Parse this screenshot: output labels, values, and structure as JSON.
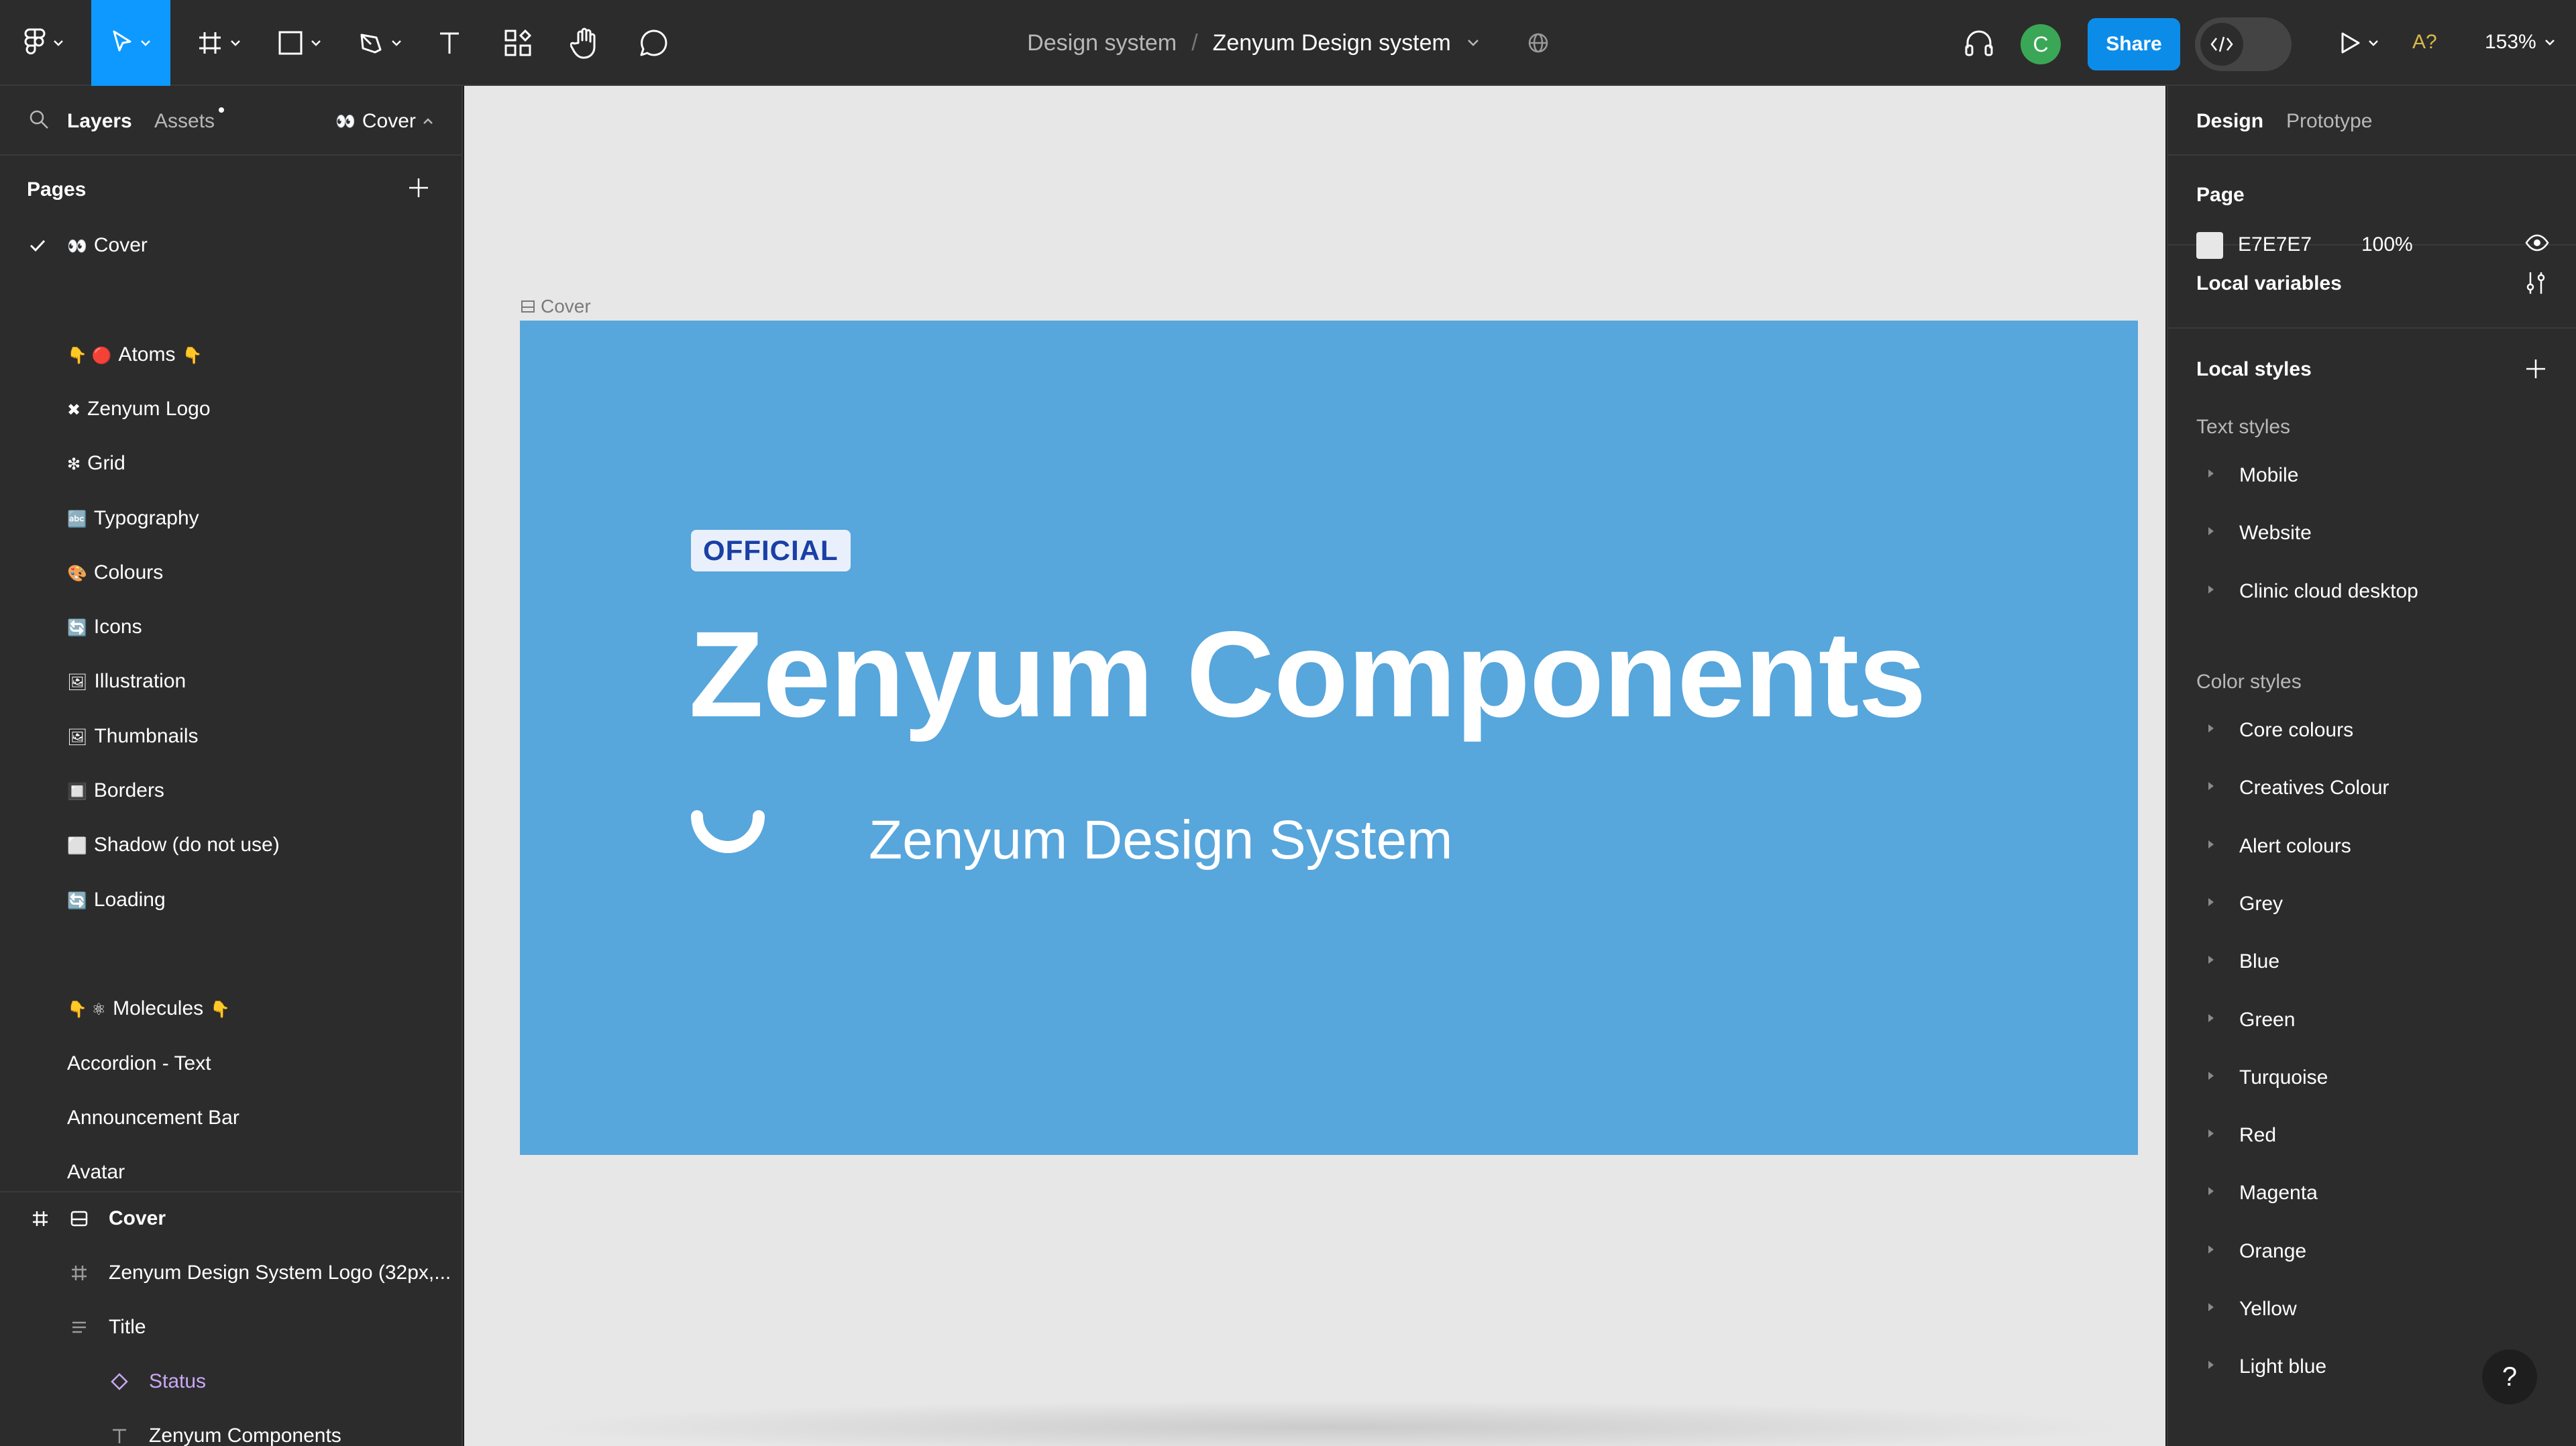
{
  "toolbar": {
    "breadcrumb_project": "Design system",
    "breadcrumb_separator": "/",
    "breadcrumb_file": "Zenyum Design system",
    "avatar_initial": "C",
    "share_label": "Share",
    "a_label": "A?",
    "zoom": "153%",
    "colors": {
      "active": "#0d99ff",
      "share": "#0c8ce9",
      "avatar": "#3aa756"
    }
  },
  "left_panel": {
    "tabs": {
      "layers": "Layers",
      "assets": "Assets"
    },
    "current_page": "Cover",
    "pages_heading": "Pages",
    "pages": [
      {
        "label": "Cover",
        "emoji": "👀",
        "selected": true
      },
      {
        "label": "",
        "emoji": ""
      },
      {
        "label": "Atoms",
        "emoji": "👇 🔴",
        "trail": "👇"
      },
      {
        "label": "Zenyum Logo",
        "emoji": "✖"
      },
      {
        "label": "Grid",
        "emoji": "❇"
      },
      {
        "label": "Typography",
        "emoji": "🔤"
      },
      {
        "label": "Colours",
        "emoji": "🎨"
      },
      {
        "label": "Icons",
        "emoji": "🔄"
      },
      {
        "label": "Illustration",
        "emoji": "🖼"
      },
      {
        "label": "Thumbnails",
        "emoji": "🖼"
      },
      {
        "label": "Borders",
        "emoji": "🔲"
      },
      {
        "label": "Shadow (do not use)",
        "emoji": "⬜"
      },
      {
        "label": "Loading",
        "emoji": "🔄"
      },
      {
        "label": "",
        "emoji": ""
      },
      {
        "label": "Molecules",
        "emoji": "👇 ⚛",
        "trail": "👇"
      },
      {
        "label": "Accordion - Text",
        "emoji": ""
      },
      {
        "label": "Announcement Bar",
        "emoji": ""
      },
      {
        "label": "Avatar",
        "emoji": ""
      }
    ],
    "layers": [
      {
        "name": "Cover",
        "kind": "frame",
        "bold": true
      },
      {
        "name": "Zenyum Design System Logo (32px,...",
        "kind": "frame"
      },
      {
        "name": "Title",
        "kind": "autolayout"
      },
      {
        "name": "Status",
        "kind": "instance",
        "color": "#c9a8f5"
      },
      {
        "name": "Zenyum Components",
        "kind": "text"
      }
    ]
  },
  "canvas": {
    "background": "#e7e7e7",
    "frame_label": "Cover",
    "frame_color": "#57a6dc",
    "badge": "OFFICIAL",
    "title": "Zenyum Components",
    "subtitle": "Zenyum Design System"
  },
  "right_panel": {
    "tabs": {
      "design": "Design",
      "prototype": "Prototype"
    },
    "page_heading": "Page",
    "page_color_hex": "E7E7E7",
    "page_opacity": "100%",
    "local_variables": "Local variables",
    "local_styles": "Local styles",
    "text_styles_heading": "Text styles",
    "text_styles": [
      "Mobile",
      "Website",
      "Clinic cloud desktop"
    ],
    "color_styles_heading": "Color styles",
    "color_styles": [
      "Core colours",
      "Creatives Colour",
      "Alert colours",
      "Grey",
      "Blue",
      "Green",
      "Turquoise",
      "Red",
      "Magenta",
      "Orange",
      "Yellow",
      "Light blue"
    ]
  },
  "help_label": "?"
}
